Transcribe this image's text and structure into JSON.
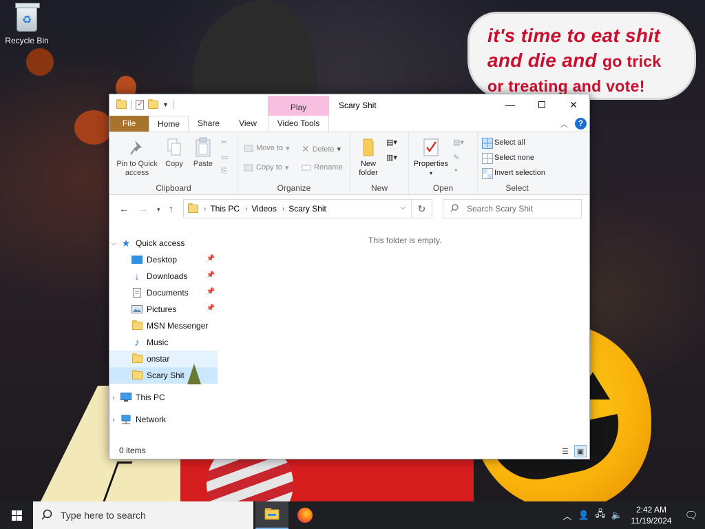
{
  "desktop": {
    "recycle_bin_label": "Recycle Bin",
    "wallpaper_text": {
      "line1": "it's time to eat shit",
      "line2_a": "and die and",
      "line2_b": "go trick",
      "line3": "or treating and vote!"
    }
  },
  "window": {
    "title": "Scary Shit",
    "contextual_tab_group": "Play",
    "tabs": [
      "File",
      "Home",
      "Share",
      "View",
      "Video Tools"
    ],
    "ribbon": {
      "clipboard": {
        "label": "Clipboard",
        "pin": "Pin to Quick access",
        "copy": "Copy",
        "paste": "Paste"
      },
      "organize": {
        "label": "Organize",
        "move_to": "Move to",
        "copy_to": "Copy to",
        "delete": "Delete",
        "rename": "Rename"
      },
      "new": {
        "label": "New",
        "new_folder": "New folder"
      },
      "open": {
        "label": "Open",
        "properties": "Properties"
      },
      "select": {
        "label": "Select",
        "select_all": "Select all",
        "select_none": "Select none",
        "invert": "Invert selection"
      }
    },
    "address": {
      "segments": [
        "This PC",
        "Videos",
        "Scary Shit"
      ]
    },
    "search_placeholder": "Search Scary Shit",
    "nav": {
      "quick_access": "Quick access",
      "items": [
        "Desktop",
        "Downloads",
        "Documents",
        "Pictures",
        "MSN Messenger",
        "Music",
        "onstar",
        "Scary Shit"
      ],
      "this_pc": "This PC",
      "network": "Network"
    },
    "empty_message": "This folder is empty.",
    "status": "0 items"
  },
  "taskbar": {
    "search_placeholder": "Type here to search",
    "time": "2:42 AM",
    "date": "11/19/2024"
  },
  "colors": {
    "file_tab": "#a8742b",
    "contextual_tab": "#f8bfe0",
    "selection": "#cce8ff",
    "accent": "#1a6fc9"
  }
}
